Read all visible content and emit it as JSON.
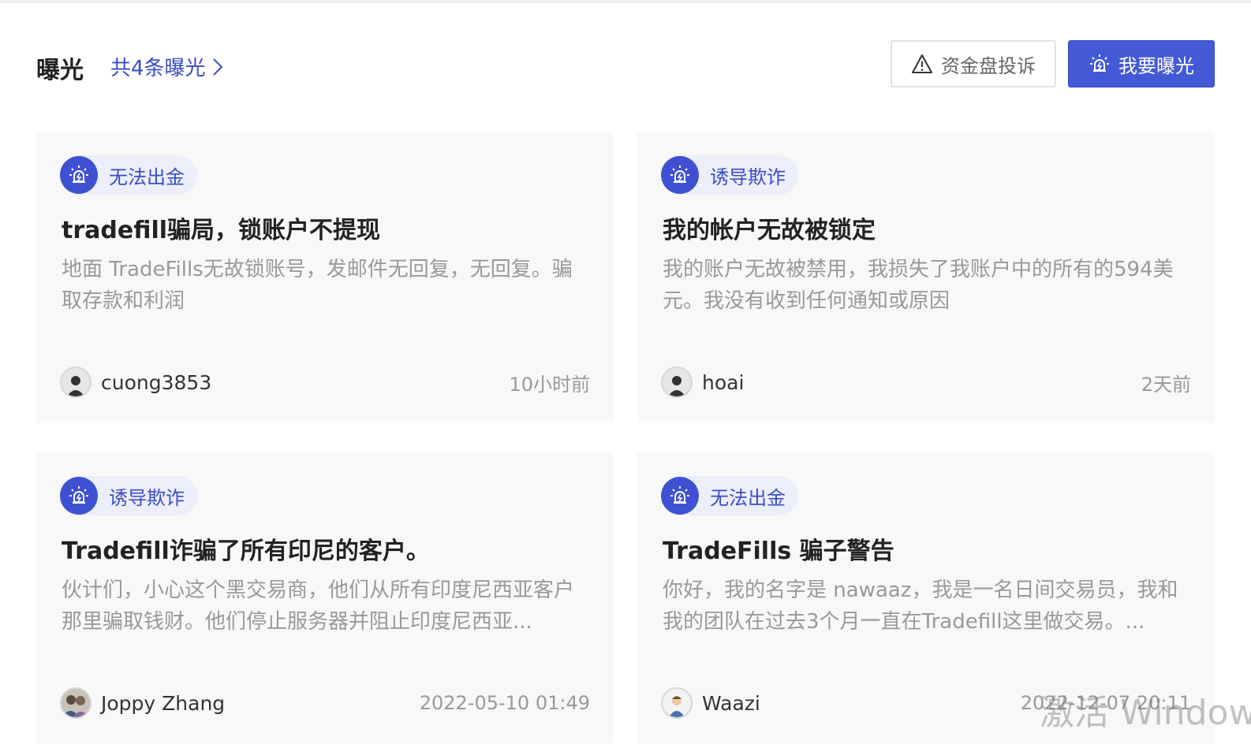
{
  "header": {
    "title": "曝光",
    "count_link": "共4条曝光",
    "complaint_button": "资金盘投诉",
    "expose_button": "我要曝光"
  },
  "cards": [
    {
      "tag": "无法出金",
      "title": "tradefill骗局，锁账户不提现",
      "description": "地面 TradeFills无故锁账号，发邮件无回复，无回复。骗取存款和利润",
      "username": "cuong3853",
      "time": "10小时前"
    },
    {
      "tag": "诱导欺诈",
      "title": "我的帐户无故被锁定",
      "description": "我的账户无故被禁用，我损失了我账户中的所有的594美元。我没有收到任何通知或原因",
      "username": "hoai",
      "time": "2天前"
    },
    {
      "tag": "诱导欺诈",
      "title": "Tradefill诈骗了所有印尼的客户。",
      "description": "伙计们，小心这个黑交易商，他们从所有印度尼西亚客户那里骗取钱财。他们停止服务器并阻止印度尼西亚...",
      "username": "Joppy Zhang",
      "time": "2022-05-10 01:49"
    },
    {
      "tag": "无法出金",
      "title": "TradeFills 骗子警告",
      "description": "你好，我的名字是 nawaaz，我是一名日间交易员，我和我的团队在过去3个月一直在Tradefill这里做交易。...",
      "username": "Waazi",
      "time": "2022-12-07 20:11"
    }
  ],
  "watermark": "激活 Window",
  "colors": {
    "accent": "#4459d6",
    "tag_bg": "#eceef9",
    "card_bg": "#f8f8f9"
  },
  "icons": {
    "tag": "alarm-icon",
    "complaint": "warning-triangle-icon",
    "expose": "alarm-icon",
    "more": "chevron-right-icon"
  }
}
